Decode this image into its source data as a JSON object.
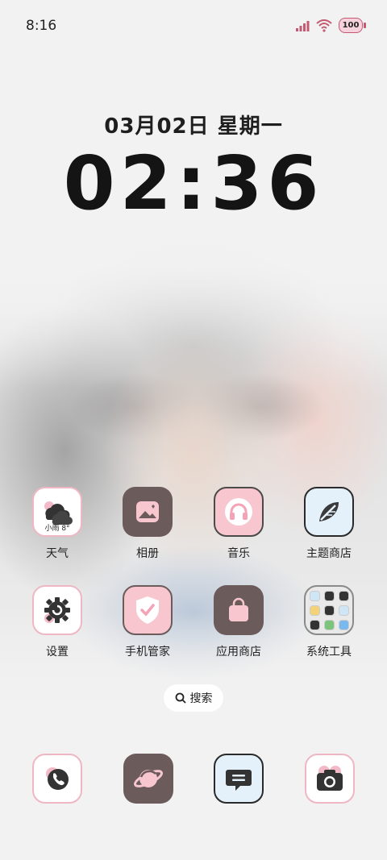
{
  "status_bar": {
    "time": "8:16",
    "battery": "100"
  },
  "lockclock": {
    "date": "03月02日  星期一",
    "time": "02:36"
  },
  "apps_row1": [
    {
      "label": "天气",
      "icon": "cloud-icon",
      "widget_text": "小雨 8°"
    },
    {
      "label": "相册",
      "icon": "image-icon"
    },
    {
      "label": "音乐",
      "icon": "headphones-icon"
    },
    {
      "label": "主题商店",
      "icon": "leaf-brush-icon"
    }
  ],
  "apps_row2": [
    {
      "label": "设置",
      "icon": "gear-icon"
    },
    {
      "label": "手机管家",
      "icon": "shield-check-icon"
    },
    {
      "label": "应用商店",
      "icon": "shopping-bag-icon"
    },
    {
      "label": "系统工具",
      "icon": "folder-icon"
    }
  ],
  "search": {
    "label": "搜索"
  },
  "dock": [
    {
      "icon": "phone-icon"
    },
    {
      "icon": "planet-icon"
    },
    {
      "icon": "message-icon"
    },
    {
      "icon": "camera-icon"
    }
  ],
  "colors": {
    "pink": "#f7c6cf",
    "brown": "#6b5b5b",
    "accent": "#efb7c4"
  }
}
